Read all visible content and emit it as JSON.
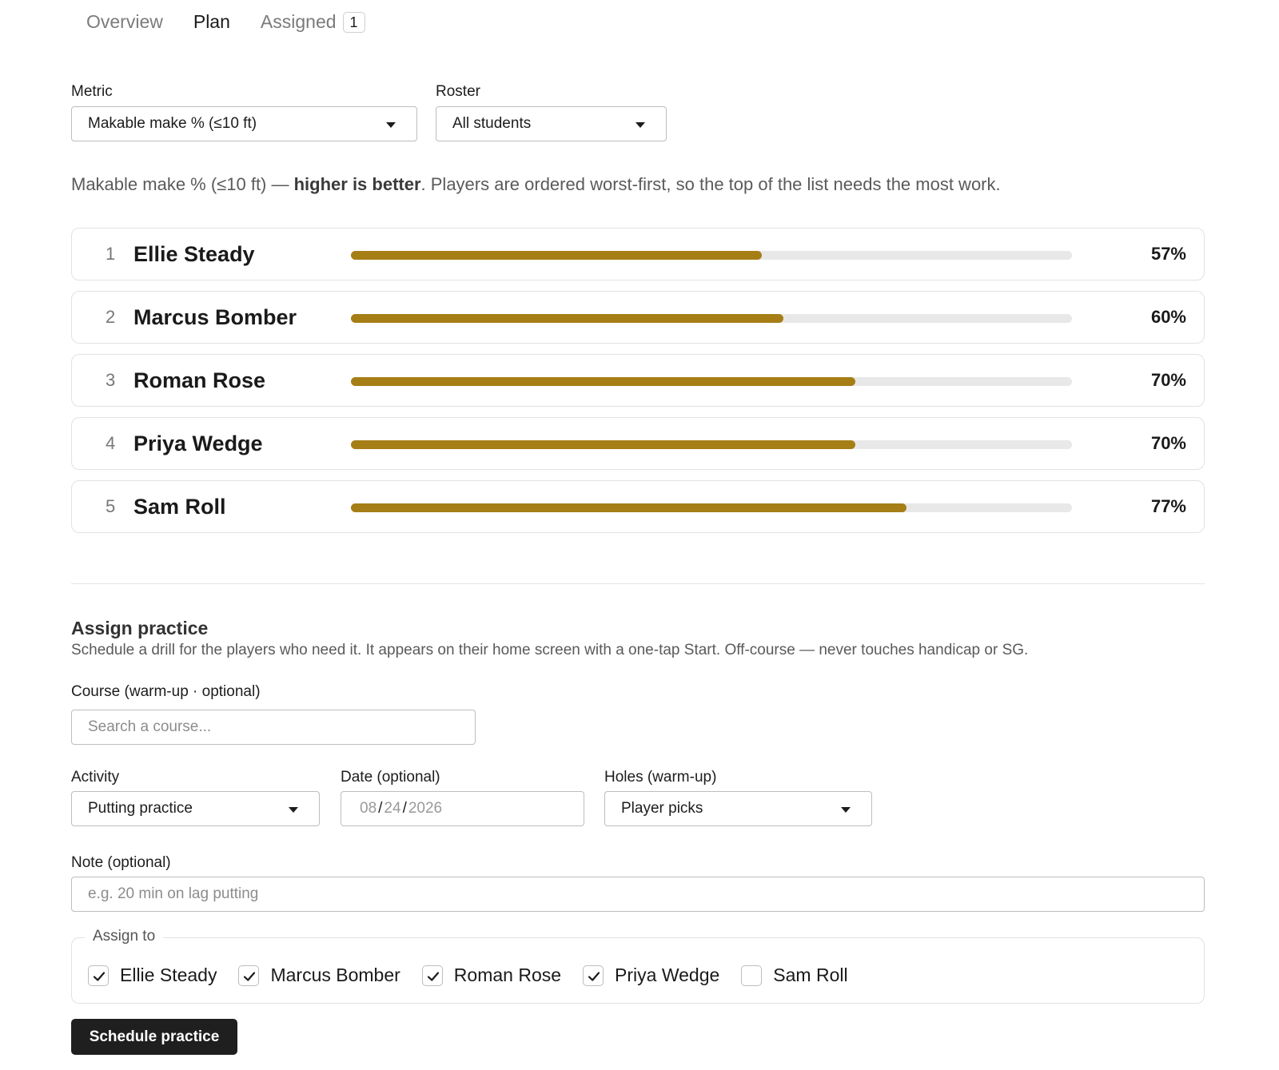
{
  "tabs": [
    {
      "label": "Overview",
      "active": false
    },
    {
      "label": "Plan",
      "active": true
    },
    {
      "label": "Assigned",
      "active": false,
      "badge": "1"
    }
  ],
  "filters": {
    "metric_label": "Metric",
    "metric_value": "Makable make % (≤10 ft)",
    "roster_label": "Roster",
    "roster_value": "All students"
  },
  "description": {
    "prefix": "Makable make % (≤10 ft) — ",
    "emphasis": "higher is better",
    "suffix": ". Players are ordered worst-first, so the top of the list needs the most work."
  },
  "ranking": [
    {
      "rank": "1",
      "name": "Ellie Steady",
      "value_label": "57%",
      "value": 57
    },
    {
      "rank": "2",
      "name": "Marcus Bomber",
      "value_label": "60%",
      "value": 60
    },
    {
      "rank": "3",
      "name": "Roman Rose",
      "value_label": "70%",
      "value": 70
    },
    {
      "rank": "4",
      "name": "Priya Wedge",
      "value_label": "70%",
      "value": 70
    },
    {
      "rank": "5",
      "name": "Sam Roll",
      "value_label": "77%",
      "value": 77
    }
  ],
  "bar_color": "#a67e16",
  "assign": {
    "title": "Assign practice",
    "description": "Schedule a drill for the players who need it. It appears on their home screen with a one-tap Start. Off-course — never touches handicap or SG.",
    "course_label": "Course (warm-up · optional)",
    "course_placeholder": "Search a course...",
    "activity_label": "Activity",
    "activity_value": "Putting practice",
    "date_label": "Date (optional)",
    "date_month": "08",
    "date_day": "24",
    "date_year": "2026",
    "holes_label": "Holes (warm-up)",
    "holes_value": "Player picks",
    "note_label": "Note (optional)",
    "note_placeholder": "e.g. 20 min on lag putting",
    "assign_to_label": "Assign to",
    "players": [
      {
        "name": "Ellie Steady",
        "checked": true
      },
      {
        "name": "Marcus Bomber",
        "checked": true
      },
      {
        "name": "Roman Rose",
        "checked": true
      },
      {
        "name": "Priya Wedge",
        "checked": true
      },
      {
        "name": "Sam Roll",
        "checked": false
      }
    ],
    "submit_label": "Schedule practice"
  }
}
